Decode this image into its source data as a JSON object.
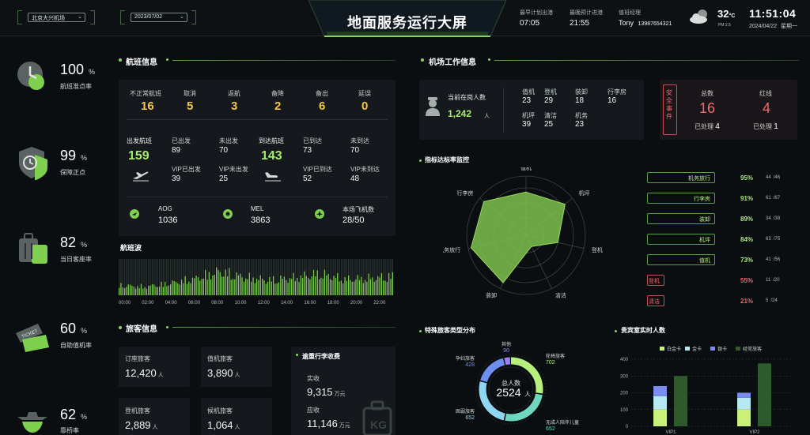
{
  "header": {
    "title": "地面服务运行大屏",
    "airport_select": "北京大兴机场",
    "date_select": "2023/07/02",
    "earliest_departure_label": "最早计划出港",
    "earliest_departure_value": "07:05",
    "latest_arrival_label": "最晚预计进港",
    "latest_arrival_value": "21:55",
    "duty_manager_label": "值班经理",
    "duty_manager_name": "Tony",
    "duty_manager_phone": "13987654321",
    "temperature": "32",
    "temperature_unit": "°C",
    "air_quality": "PM 2.5",
    "time": "11:51:04",
    "date": "2024/04/22",
    "weekday": "星期一"
  },
  "kpis": [
    {
      "value": "100",
      "unit": "%",
      "label": "航班准点率",
      "icon": "clock-icon"
    },
    {
      "value": "99",
      "unit": "%",
      "label": "保障正点",
      "icon": "shield-clock-icon"
    },
    {
      "value": "82",
      "unit": "%",
      "label": "当日客座率",
      "icon": "luggage-icon"
    },
    {
      "value": "60",
      "unit": "%",
      "label": "自助值机率",
      "icon": "ticket-icon"
    },
    {
      "value": "62",
      "unit": "%",
      "label": "靠桥率",
      "icon": "plane-icon"
    }
  ],
  "flight_info": {
    "title": "航班信息",
    "abnormal": [
      {
        "label": "不正常航班",
        "value": "16"
      },
      {
        "label": "取消",
        "value": "5"
      },
      {
        "label": "返航",
        "value": "3"
      },
      {
        "label": "备降",
        "value": "2"
      },
      {
        "label": "备出",
        "value": "6"
      },
      {
        "label": "延误",
        "value": "0"
      }
    ],
    "departure_label": "出发航班",
    "departure_value": "159",
    "dep_done_label": "已出发",
    "dep_done_value": "89",
    "dep_pending_label": "未出发",
    "dep_pending_value": "70",
    "dep_vip_done_label": "VIP已出发",
    "dep_vip_done_value": "39",
    "dep_vip_pending_label": "VIP未出发",
    "dep_vip_pending_value": "25",
    "arrival_label": "到达航班",
    "arrival_value": "143",
    "arr_done_label": "已到达",
    "arr_done_value": "73",
    "arr_pending_label": "未到达",
    "arr_pending_value": "70",
    "arr_vip_done_label": "VIP已到达",
    "arr_vip_done_value": "52",
    "arr_vip_pending_label": "VIP未到达",
    "arr_vip_pending_value": "48",
    "aog_label": "AOG",
    "aog_value": "1036",
    "mel_label": "MEL",
    "mel_value": "3863",
    "local_aircraft_label": "本场飞机数",
    "local_aircraft_value": "28/50"
  },
  "wave": {
    "title": "航班波",
    "ticks": [
      "00:00",
      "02:00",
      "04:00",
      "06:00",
      "08:00",
      "10:00",
      "12:00",
      "14:00",
      "16:00",
      "18:00",
      "20:00",
      "22:00"
    ]
  },
  "passenger_info": {
    "title": "旅客信息",
    "booked_label": "订座旅客",
    "booked_value": "12,420",
    "person_unit": "人",
    "checked_label": "值机旅客",
    "checked_value": "3,890",
    "boarded_label": "登机旅客",
    "boarded_value": "2,889",
    "waiting_label": "候机旅客",
    "waiting_value": "1,064",
    "baggage_title": "逾重行李收费",
    "actual_label": "实收",
    "actual_value": "9,315",
    "money_unit": "万元",
    "due_label": "应收",
    "due_value": "11,146"
  },
  "staff": {
    "title": "机场工作信息",
    "on_duty_label": "当前在岗人数",
    "on_duty_value": "1,242",
    "on_duty_unit": "人",
    "items": [
      {
        "label": "值机",
        "value": "23"
      },
      {
        "label": "登机",
        "value": "29"
      },
      {
        "label": "装卸",
        "value": "18"
      },
      {
        "label": "行李房",
        "value": "16"
      },
      {
        "label": "机坪",
        "value": "39"
      },
      {
        "label": "清洁",
        "value": "25"
      },
      {
        "label": "机务",
        "value": "23"
      }
    ],
    "safety_label": "安全事件",
    "total_label": "总数",
    "total_value": "16",
    "total_handled_label": "已处理",
    "total_handled_value": "4",
    "red_label": "红线",
    "red_value": "4",
    "red_handled_label": "已处理",
    "red_handled_value": "1"
  },
  "kpi_monitor": {
    "title": "指标达标率监控",
    "rows": [
      {
        "label": "机务放行",
        "pct": "95%",
        "count": "44",
        "total": "/46",
        "ok": true
      },
      {
        "label": "行李房",
        "pct": "91%",
        "count": "61",
        "total": "/67",
        "ok": true
      },
      {
        "label": "装卸",
        "pct": "89%",
        "count": "34",
        "total": "/38",
        "ok": true
      },
      {
        "label": "机坪",
        "pct": "84%",
        "count": "63",
        "total": "/75",
        "ok": true
      },
      {
        "label": "值机",
        "pct": "73%",
        "count": "41",
        "total": "/56",
        "ok": true
      },
      {
        "label": "登机",
        "pct": "55%",
        "count": "11",
        "total": "/20",
        "ok": false
      },
      {
        "label": "清洁",
        "pct": "21%",
        "count": "5",
        "total": "/24",
        "ok": false
      }
    ]
  },
  "special_passengers": {
    "title": "特殊旅客类型分布",
    "center_label": "总人数",
    "center_value": "2524",
    "center_unit": "人"
  },
  "vip_lounge": {
    "title": "贵宾室实时人数",
    "y_ticks": [
      "400",
      "300",
      "200",
      "100",
      "0"
    ]
  },
  "chart_data": [
    {
      "type": "bar",
      "title": "航班波",
      "categories": [
        "00:00",
        "02:00",
        "04:00",
        "06:00",
        "08:00",
        "10:00",
        "12:00",
        "14:00",
        "16:00",
        "18:00",
        "20:00",
        "22:00"
      ],
      "values": [
        0.38,
        0.32,
        0.45,
        0.62,
        0.9,
        0.68,
        0.58,
        0.66,
        0.82,
        0.6,
        0.64,
        0.72
      ]
    },
    {
      "type": "radar",
      "title": "指标达标率监控",
      "categories": [
        "值机",
        "机坪",
        "登机",
        "清洁",
        "装卸",
        "机务放行",
        "行李房"
      ],
      "values": [
        73,
        84,
        55,
        21,
        89,
        95,
        91
      ],
      "rmax": 100
    },
    {
      "type": "pie",
      "title": "特殊旅客类型分布",
      "series": [
        {
          "name": "轮椅旅客",
          "value": 702,
          "color": "#b7f07d"
        },
        {
          "name": "无成人陪伴儿童",
          "value": 652,
          "color": "#6fd6c0"
        },
        {
          "name": "困弱旅客",
          "value": 652,
          "color": "#8fd6f0"
        },
        {
          "name": "孕妇旅客",
          "value": 428,
          "color": "#6f8ff0"
        },
        {
          "name": "其他",
          "value": 90,
          "color": "#9b7ff0"
        }
      ]
    },
    {
      "type": "bar",
      "title": "贵宾室实时人数",
      "categories": [
        "VIP1",
        "VIP2"
      ],
      "ylim": [
        0,
        400
      ],
      "legend": [
        "白金卡",
        "金卡",
        "银卡",
        "经常旅客"
      ],
      "legend_colors": [
        "#c8f07a",
        "#b6e8f0",
        "#7a8cf0",
        "#2e5a2e"
      ],
      "series": [
        {
          "name": "白金卡",
          "values": [
            100,
            100
          ]
        },
        {
          "name": "金卡",
          "values": [
            80,
            70
          ]
        },
        {
          "name": "银卡",
          "values": [
            60,
            30
          ]
        },
        {
          "name": "经常旅客",
          "values": [
            300,
            375
          ]
        }
      ]
    }
  ]
}
